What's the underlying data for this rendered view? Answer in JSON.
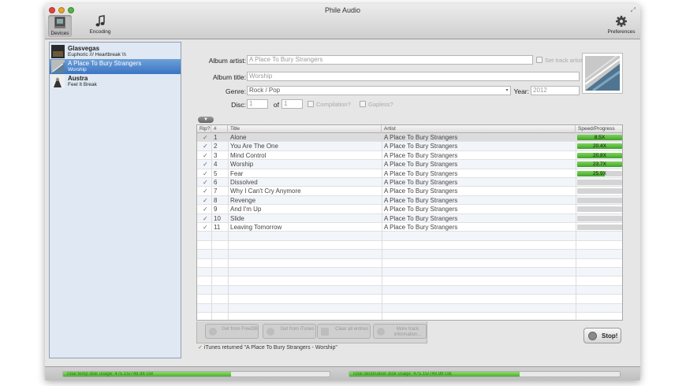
{
  "window": {
    "title": "Phile Audio",
    "toolbar": {
      "devices_label": "Devices",
      "encoding_label": "Encoding",
      "preferences_label": "Preferences"
    }
  },
  "sidebar": {
    "items": [
      {
        "artist": "Glasvegas",
        "album": "Euphoric /// Heartbreak \\\\\\",
        "selected": false
      },
      {
        "artist": "A Place To Bury Strangers",
        "album": "Worship",
        "selected": true
      },
      {
        "artist": "Austra",
        "album": "Feel It Break",
        "selected": false
      }
    ]
  },
  "form": {
    "album_artist_label": "Album artist:",
    "album_artist_value": "A Place To Bury Strangers",
    "set_track_artist_label": "Set track artist",
    "album_title_label": "Album title:",
    "album_title_value": "Worship",
    "genre_label": "Genre:",
    "genre_value": "Rock / Pop",
    "year_label": "Year:",
    "year_value": "2012",
    "disc_label": "Disc:",
    "disc_value": "1",
    "of_label": "of",
    "disc_total": "1",
    "compilation_label": "Compilation?",
    "gapless_label": "Gapless?"
  },
  "table": {
    "headers": {
      "rip": "Rip?",
      "num": "#",
      "title": "Title",
      "artist": "Artist",
      "speed": "Speed/Progress"
    },
    "rows": [
      {
        "rip": "✓",
        "num": "1",
        "title": "Alone",
        "artist": "A Place To Bury Strangers",
        "speed": "8.5X",
        "progress": 1.0
      },
      {
        "rip": "✓",
        "num": "2",
        "title": "You Are The One",
        "artist": "A Place To Bury Strangers",
        "speed": "20.4X",
        "progress": 1.0
      },
      {
        "rip": "✓",
        "num": "3",
        "title": "Mind Control",
        "artist": "A Place To Bury Strangers",
        "speed": "20.8X",
        "progress": 1.0
      },
      {
        "rip": "✓",
        "num": "4",
        "title": "Worship",
        "artist": "A Place To Bury Strangers",
        "speed": "23.7X",
        "progress": 1.0
      },
      {
        "rip": "✓",
        "num": "5",
        "title": "Fear",
        "artist": "A Place To Bury Strangers",
        "speed": "25.9X",
        "progress": 0.62
      },
      {
        "rip": "✓",
        "num": "6",
        "title": "Dissolved",
        "artist": "A Place To Bury Strangers",
        "speed": "",
        "progress": 0
      },
      {
        "rip": "✓",
        "num": "7",
        "title": "Why I Can't Cry Anymore",
        "artist": "A Place To Bury Strangers",
        "speed": "",
        "progress": 0
      },
      {
        "rip": "✓",
        "num": "8",
        "title": "Revenge",
        "artist": "A Place To Bury Strangers",
        "speed": "",
        "progress": 0
      },
      {
        "rip": "✓",
        "num": "9",
        "title": "And I'm Up",
        "artist": "A Place To Bury Strangers",
        "speed": "",
        "progress": 0
      },
      {
        "rip": "✓",
        "num": "10",
        "title": "Slide",
        "artist": "A Place To Bury Strangers",
        "speed": "",
        "progress": 0
      },
      {
        "rip": "✓",
        "num": "11",
        "title": "Leaving Tomorrow",
        "artist": "A Place To Bury Strangers",
        "speed": "",
        "progress": 0
      }
    ]
  },
  "actions": {
    "freedb": "Get from FreeDB",
    "itunes": "Get from iTunes",
    "clear": "Clear all entries",
    "more_info": "More track information...",
    "stop": "Stop!"
  },
  "status_message": "iTunes returned \"A Place To Bury Strangers - Worship\"",
  "footer": {
    "temp_disk": "Total temp disk usage: 475.15/748.98 GB",
    "temp_fraction": 0.63,
    "dest_disk": "Total destination disk usage: 475.15/748.98 GB",
    "dest_fraction": 0.63
  },
  "colors": {
    "selection": "#3b74c4",
    "progress_green": "#3fa22a",
    "sidebar_bg": "#dfe8f3"
  }
}
